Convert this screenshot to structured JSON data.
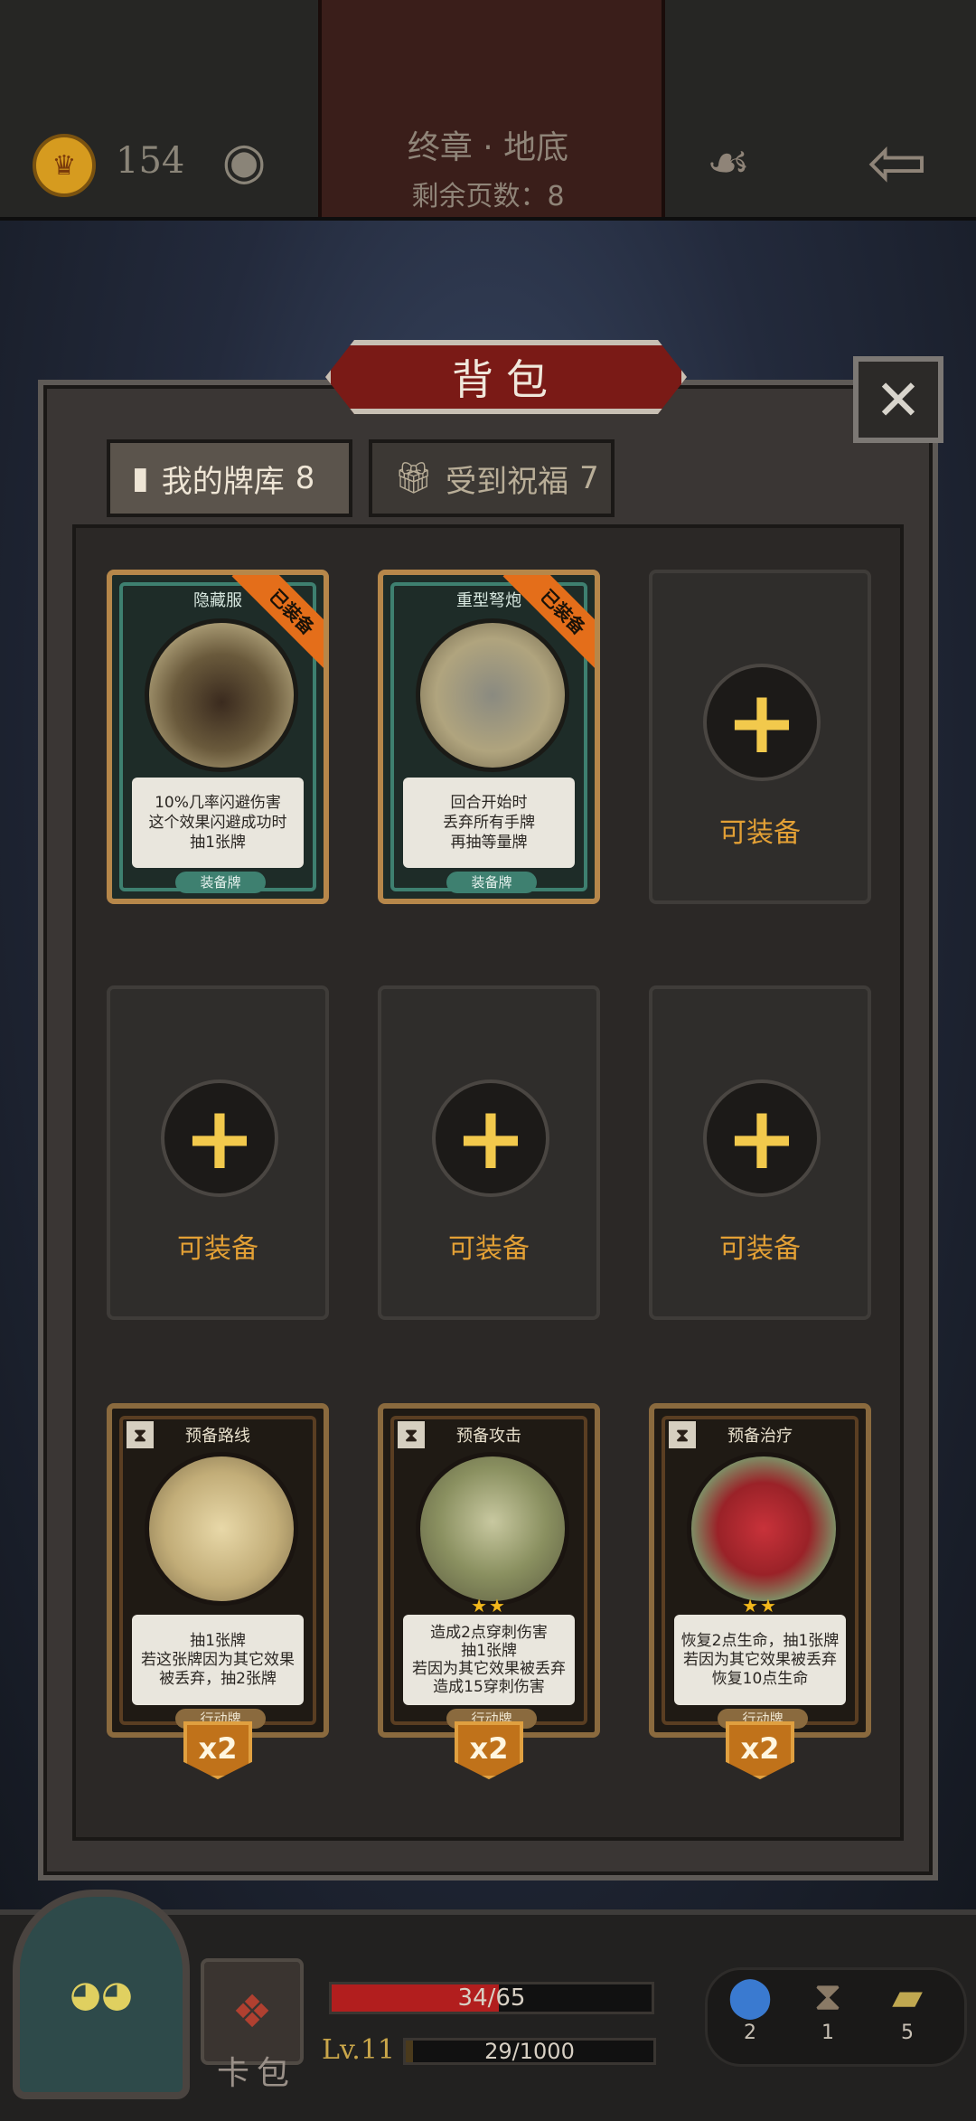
{
  "topbar": {
    "gold": "154",
    "chapter_title": "终章 · 地底",
    "pages_remaining": "剩余页数：8"
  },
  "backpack": {
    "title": "背包",
    "tabs": [
      {
        "label": "我的牌库",
        "count": "8",
        "icon": "card-stack-icon",
        "active": true
      },
      {
        "label": "受到祝福",
        "count": "7",
        "icon": "gift-icon",
        "active": false
      }
    ]
  },
  "equipped_cards": [
    {
      "name": "隐藏服",
      "badge": "已装备",
      "desc": [
        "10%几率闪避伤害",
        "这个效果闪避成功时",
        "抽1张牌"
      ],
      "type": "装备牌"
    },
    {
      "name": "重型弩炮",
      "badge": "已装备",
      "desc": [
        "回合开始时",
        "丢弃所有手牌",
        "再抽等量牌"
      ],
      "type": "装备牌"
    }
  ],
  "empty_slot_label": "可装备",
  "action_cards": [
    {
      "name": "预备路线",
      "stars": "",
      "desc": [
        "抽1张牌",
        "若这张牌因为其它效果",
        "被丢弃，抽2张牌"
      ],
      "type": "行动牌",
      "multiplier": "x2"
    },
    {
      "name": "预备攻击",
      "stars": "★★",
      "desc": [
        "造成2点穿刺伤害",
        "抽1张牌",
        "若因为其它效果被丢弃",
        "造成15穿刺伤害"
      ],
      "type": "行动牌",
      "multiplier": "x2"
    },
    {
      "name": "预备治疗",
      "stars": "★★",
      "desc": [
        "恢复2点生命，抽1张牌",
        "若因为其它效果被丢弃",
        "恢复10点生命"
      ],
      "type": "行动牌",
      "multiplier": "x2"
    }
  ],
  "player": {
    "deck_label": "卡包",
    "hp_text": "34/65",
    "hp_fraction": 0.523,
    "level": "Lv.11",
    "xp_text": "29/1000",
    "xp_fraction": 0.029
  },
  "resources": [
    {
      "icon": "potion-icon",
      "count": "2"
    },
    {
      "icon": "hourglass-icon",
      "count": "1"
    },
    {
      "icon": "cards-icon",
      "count": "5"
    }
  ],
  "colors": {
    "accent_gold": "#e3a035",
    "hp_red": "#b21e1e",
    "equip_badge": "#e46e1a"
  }
}
